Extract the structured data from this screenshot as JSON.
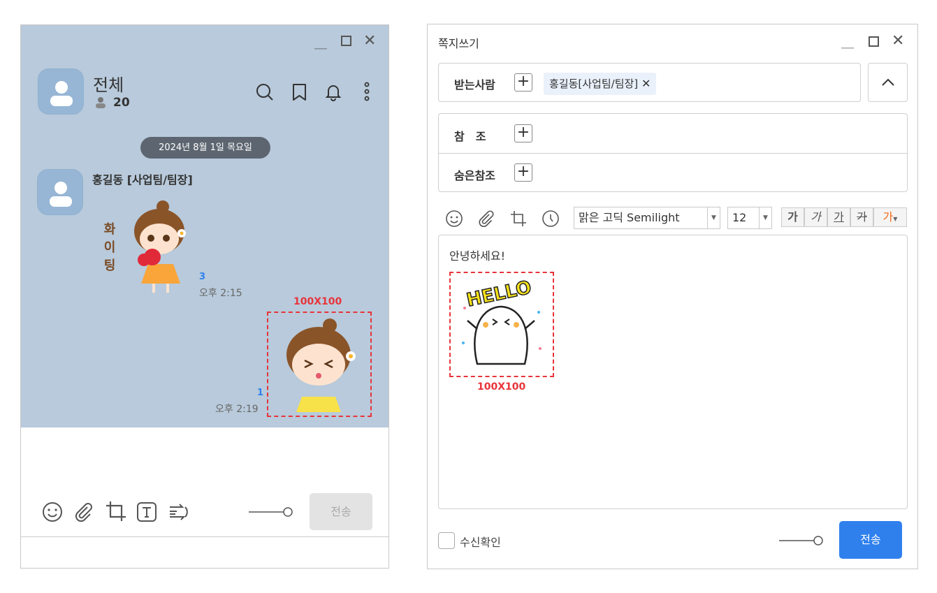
{
  "chat_window": {
    "title": "전체",
    "member_count": "20",
    "date_divider": "2024년 8월 1일 목요일",
    "messages": [
      {
        "sender": "홍길동 [사업팀/팀장]",
        "sticker_text": "화이팅",
        "unread": "3",
        "time": "오후 2:15"
      },
      {
        "size_label": "100X100",
        "unread": "1",
        "time": "오후 2:19"
      }
    ],
    "send_label": "전송"
  },
  "compose_window": {
    "title": "쪽지쓰기",
    "to_label": "받는사람",
    "to_chip": "홍길동[사업팀/팀장]",
    "cc_label": "참　조",
    "bcc_label": "숨은참조",
    "font_name": "맑은 고딕 Semilight",
    "font_size": "12",
    "format_buttons": [
      "가",
      "가",
      "가",
      "가",
      "가"
    ],
    "body_text": "안녕하세요!",
    "sticker_text": "HELLO",
    "size_label": "100X100",
    "read_receipt_label": "수신확인",
    "send_label": "전송",
    "colors": {
      "accent": "#2f80ed",
      "dash": "#e8343a",
      "chat_bg": "#b8cadb"
    }
  }
}
